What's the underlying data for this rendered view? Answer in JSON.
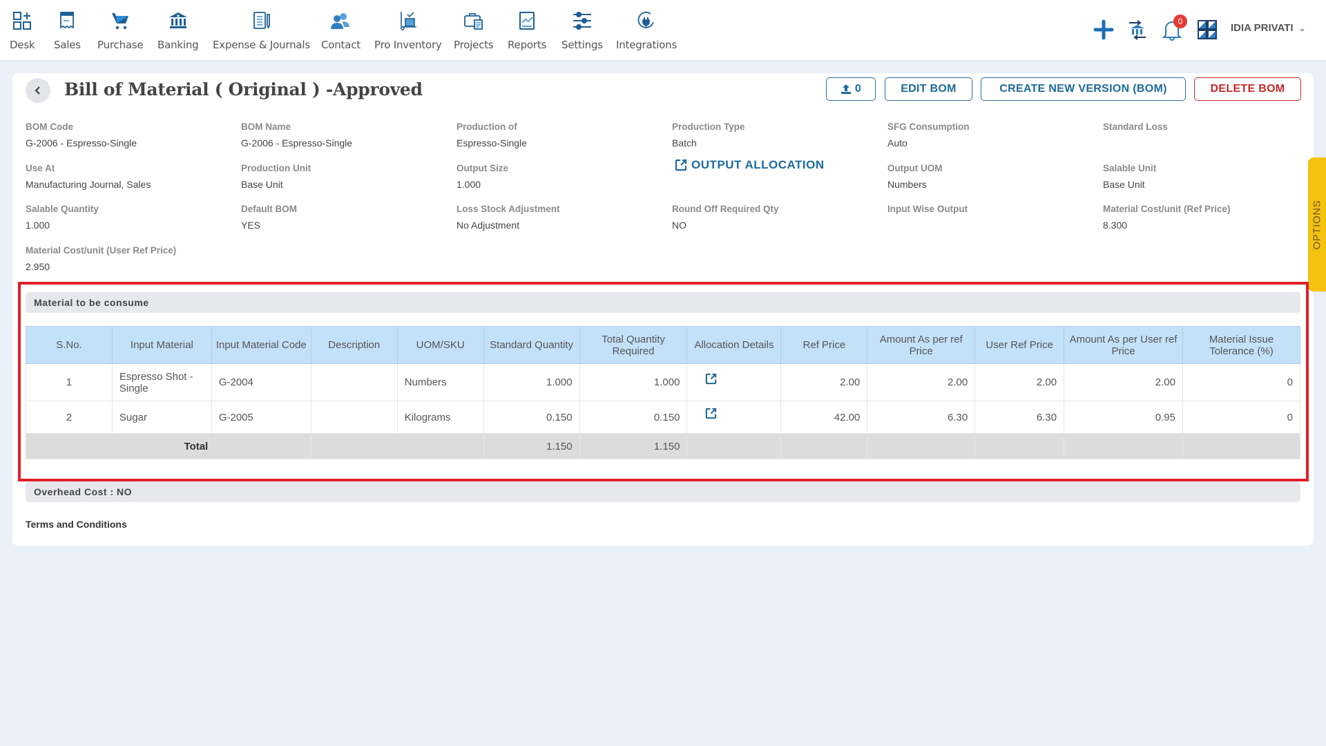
{
  "nav": {
    "items": [
      {
        "label": "Desk",
        "icon": "desk-grid-icon"
      },
      {
        "label": "Sales",
        "icon": "receipt-icon"
      },
      {
        "label": "Purchase",
        "icon": "cart-icon"
      },
      {
        "label": "Banking",
        "icon": "bank-icon"
      },
      {
        "label": "Expense & Journals",
        "icon": "notebook-icon"
      },
      {
        "label": "Contact",
        "icon": "contacts-icon"
      },
      {
        "label": "Pro Inventory",
        "icon": "inventory-trolley-icon"
      },
      {
        "label": "Projects",
        "icon": "briefcase-icon"
      },
      {
        "label": "Reports",
        "icon": "report-chart-icon"
      },
      {
        "label": "Settings",
        "icon": "sliders-icon"
      },
      {
        "label": "Integrations",
        "icon": "plug-icon"
      }
    ],
    "notification_count": "0",
    "company": "IDIA PRIVATI",
    "accent": "#1d6a9b"
  },
  "header": {
    "title": "Bill of Material ( Original ) -Approved",
    "upload_count": "0",
    "edit_label": "EDIT BOM",
    "new_version_label": "CREATE NEW VERSION (BOM)",
    "delete_label": "DELETE BOM"
  },
  "details": {
    "bom_code": {
      "label": "BOM Code",
      "value": "G-2006 - Espresso-Single"
    },
    "bom_name": {
      "label": "BOM Name",
      "value": "G-2006 - Espresso-Single"
    },
    "production_of": {
      "label": "Production of",
      "value": "Espresso-Single"
    },
    "production_type": {
      "label": "Production Type",
      "value": "Batch"
    },
    "sfg_consumption": {
      "label": "SFG Consumption",
      "value": "Auto"
    },
    "standard_loss": {
      "label": "Standard Loss",
      "value": ""
    },
    "use_at": {
      "label": "Use At",
      "value": "Manufacturing Journal, Sales"
    },
    "production_unit": {
      "label": "Production Unit",
      "value": "Base Unit"
    },
    "output_size": {
      "label": "Output Size",
      "value": "1.000"
    },
    "output_allocation_label": "OUTPUT ALLOCATION",
    "output_uom": {
      "label": "Output UOM",
      "value": "Numbers"
    },
    "salable_unit": {
      "label": "Salable Unit",
      "value": "Base Unit"
    },
    "salable_quantity": {
      "label": "Salable Quantity",
      "value": "1.000"
    },
    "default_bom": {
      "label": "Default BOM",
      "value": "YES"
    },
    "loss_stock_adjustment": {
      "label": "Loss Stock Adjustment",
      "value": "No Adjustment"
    },
    "round_off_required_qty": {
      "label": "Round Off Required Qty",
      "value": "NO"
    },
    "input_wise_output": {
      "label": "Input Wise Output",
      "value": ""
    },
    "material_cost_ref": {
      "label": "Material Cost/unit (Ref Price)",
      "value": "8.300"
    },
    "material_cost_user_ref": {
      "label": "Material Cost/unit (User Ref Price)",
      "value": "2.950"
    }
  },
  "options_tab": "OPTIONS",
  "materials": {
    "section_title": "Material to be consume",
    "columns": [
      "S.No.",
      "Input Material",
      "Input Material Code",
      "Description",
      "UOM/SKU",
      "Standard Quantity",
      "Total Quantity Required",
      "Allocation Details",
      "Ref Price",
      "Amount As per ref Price",
      "User Ref Price",
      "Amount As per User ref Price",
      "Material Issue Tolerance (%)"
    ],
    "rows": [
      {
        "sno": "1",
        "material": "Espresso Shot - Single",
        "code": "G-2004",
        "description": "",
        "uom": "Numbers",
        "std_qty": "1.000",
        "total_qty": "1.000",
        "ref_price": "2.00",
        "amount_ref": "2.00",
        "user_ref_price": "2.00",
        "amount_user_ref": "2.00",
        "tolerance": "0"
      },
      {
        "sno": "2",
        "material": "Sugar",
        "code": "G-2005",
        "description": "",
        "uom": "Kilograms",
        "std_qty": "0.150",
        "total_qty": "0.150",
        "ref_price": "42.00",
        "amount_ref": "6.30",
        "user_ref_price": "6.30",
        "amount_user_ref": "0.95",
        "tolerance": "0"
      }
    ],
    "total": {
      "label": "Total",
      "std_qty": "1.150",
      "total_qty": "1.150"
    }
  },
  "overhead": "Overhead Cost : NO",
  "terms": "Terms and Conditions"
}
